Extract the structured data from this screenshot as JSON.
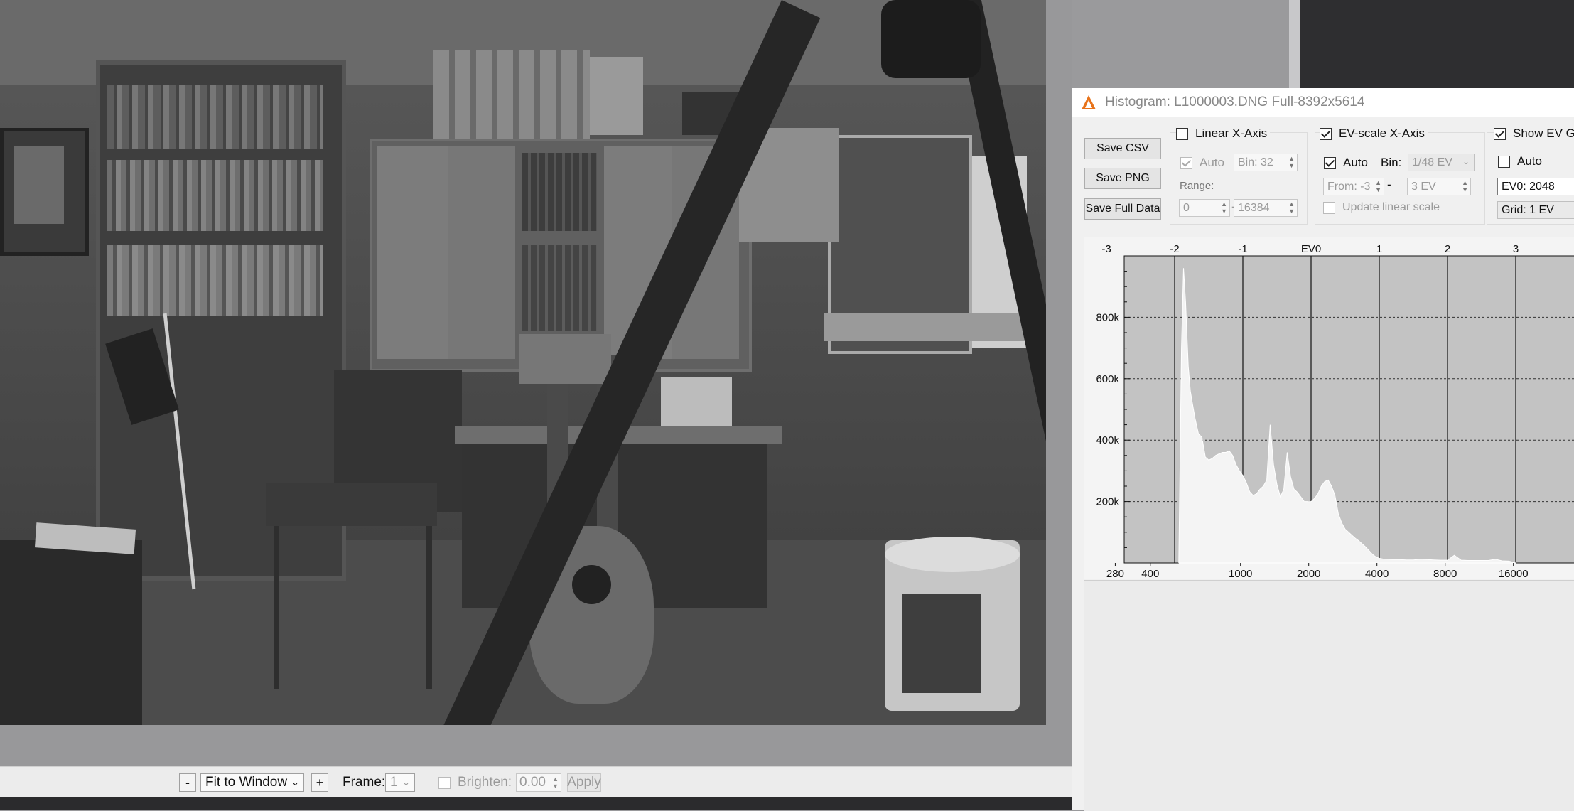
{
  "photo": {
    "subject": "",
    "icon": "photo-icon"
  },
  "toolbar": {
    "zoom_out": "-",
    "fit": "Fit to Window",
    "zoom_in": "+",
    "frame_label": "Frame:",
    "frame_value": "1",
    "brighten_label": "Brighten:",
    "brighten_value": "0.00",
    "apply": "Apply"
  },
  "histogram": {
    "title": "Histogram: L1000003.DNG Full-8392x5614",
    "buttons": {
      "save_csv": "Save CSV",
      "save_png": "Save PNG",
      "save_full": "Save Full Data"
    },
    "linear": {
      "label": "Linear X-Axis",
      "checked": false,
      "auto_label": "Auto",
      "bin": "Bin: 32",
      "range_label": "Range:",
      "range_from": "0",
      "range_sep": "-",
      "range_to": "16384"
    },
    "ev": {
      "label": "EV-scale X-Axis",
      "checked": true,
      "auto_label": "Auto",
      "bin_label": "Bin:",
      "bin_value": "1/48 EV",
      "from": "From: -3",
      "sep": "-",
      "to": "3 EV",
      "update": "Update linear scale"
    },
    "grid": {
      "show": "Show EV Gr",
      "auto_label": "Auto",
      "ev0": "EV0: 2048",
      "grid": "Grid: 1 EV"
    },
    "colors": {
      "plot_bg": "#c3c3c3",
      "fill": "#f4f4f4",
      "accent": "#e8731a"
    }
  },
  "chart_data": {
    "type": "area",
    "title": "",
    "xlabel": "",
    "ylabel": "",
    "x_scale": "log2",
    "ylim": [
      0,
      1000000
    ],
    "top_ticks": [
      "-3",
      "-2",
      "-1",
      "EV0",
      "1",
      "2",
      "3"
    ],
    "top_tick_ev": [
      -3,
      -2,
      -1,
      0,
      1,
      2,
      3
    ],
    "bottom_ticks": [
      "280",
      "400",
      "1000",
      "2000",
      "4000",
      "8000",
      "16000"
    ],
    "bottom_tick_values": [
      280,
      400,
      1000,
      2000,
      4000,
      8000,
      16000
    ],
    "y_ticks": [
      "200k",
      "400k",
      "600k",
      "800k"
    ],
    "y_tick_values": [
      200000,
      400000,
      600000,
      800000
    ],
    "series": [
      {
        "ev": [
          -1.94,
          -1.9,
          -1.87,
          -1.84,
          -1.8,
          -1.77,
          -1.74,
          -1.7,
          -1.65,
          -1.6,
          -1.55,
          -1.5,
          -1.45,
          -1.4,
          -1.35,
          -1.3,
          -1.25,
          -1.2,
          -1.15,
          -1.1,
          -1.05,
          -1.0,
          -0.95,
          -0.9,
          -0.85,
          -0.8,
          -0.75,
          -0.7,
          -0.65,
          -0.6,
          -0.55,
          -0.5,
          -0.45,
          -0.4,
          -0.35,
          -0.3,
          -0.25,
          -0.2,
          -0.15,
          -0.1,
          -0.05,
          0.0,
          0.05,
          0.1,
          0.15,
          0.2,
          0.25,
          0.3,
          0.35,
          0.4,
          0.45,
          0.5,
          0.55,
          0.6,
          0.65,
          0.7,
          0.75,
          0.8,
          0.85,
          0.9,
          0.95,
          1.0,
          1.05,
          1.1,
          1.2,
          1.3,
          1.4,
          1.5,
          1.6,
          1.7,
          1.8,
          1.9,
          2.0,
          2.1,
          2.2,
          2.3,
          2.4,
          2.5,
          2.6,
          2.7,
          2.8,
          2.9,
          3.0
        ],
        "values": [
          0,
          700000,
          960000,
          850000,
          640000,
          560000,
          520000,
          470000,
          420000,
          410000,
          345000,
          335000,
          340000,
          350000,
          355000,
          360000,
          360000,
          365000,
          350000,
          320000,
          300000,
          285000,
          262000,
          232000,
          220000,
          225000,
          240000,
          250000,
          270000,
          450000,
          320000,
          255000,
          215000,
          240000,
          360000,
          280000,
          240000,
          230000,
          215000,
          200000,
          200000,
          200000,
          210000,
          225000,
          250000,
          265000,
          270000,
          250000,
          220000,
          160000,
          130000,
          110000,
          100000,
          90000,
          80000,
          72000,
          62000,
          52000,
          40000,
          28000,
          20000,
          15000,
          13000,
          12000,
          11000,
          11000,
          10000,
          10000,
          12000,
          11000,
          10000,
          9000,
          9000,
          25000,
          9000,
          8000,
          8000,
          8000,
          8000,
          12000,
          7000,
          6000,
          0
        ]
      }
    ],
    "grid": true,
    "legend": "none"
  }
}
